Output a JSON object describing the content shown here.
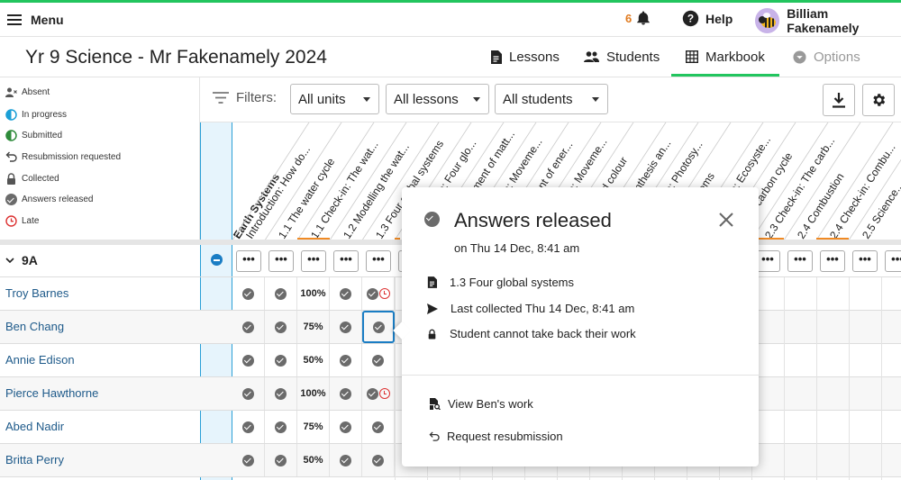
{
  "topbar": {
    "menu_label": "Menu",
    "notification_count": "6",
    "help_label": "Help",
    "user_name": "Billiam Fakenamely"
  },
  "header": {
    "title": "Yr 9 Science - Mr Fakenamely 2024",
    "tabs": [
      {
        "label": "Lessons",
        "icon": "document-icon"
      },
      {
        "label": "Students",
        "icon": "people-icon"
      },
      {
        "label": "Markbook",
        "icon": "grid-icon",
        "active": true
      },
      {
        "label": "Options",
        "icon": "chevron-circle-icon",
        "disabled": true
      }
    ]
  },
  "legend": [
    {
      "label": "Absent",
      "icon": "absent-icon"
    },
    {
      "label": "In progress",
      "icon": "in-progress-icon"
    },
    {
      "label": "Submitted",
      "icon": "submitted-icon"
    },
    {
      "label": "Resubmission requested",
      "icon": "resubmit-icon"
    },
    {
      "label": "Collected",
      "icon": "lock-icon"
    },
    {
      "label": "Answers released",
      "icon": "check-circle-icon"
    },
    {
      "label": "Late",
      "icon": "late-clock-icon"
    }
  ],
  "filters": {
    "label": "Filters:",
    "units": "All units",
    "lessons": "All lessons",
    "students": "All students"
  },
  "unit_label": "Earth Systems",
  "columns": [
    "Introduction: How do...",
    "1.1 The water cycle",
    "1.1 Check-in: The wat...",
    "1.2 Modelling the wat...",
    "1.3 Four global systems",
    "1.3 Check-in: Four glo...",
    "2.1 Management of matt...",
    "2.1 Check-in: Moveme...",
    "2.2 Movement of ener...",
    "2.2 Check-in: Moveme...",
    "2.3 Light and colour",
    "2.4 Photosynthesis an...",
    "2.4 Check-in: Photosy...",
    "2.5 Ecosystems",
    "2.5 Check-in: Ecosyste...",
    "2.3 The carbon cycle",
    "2.3 Check-in: The carb...",
    "2.4 Combustion",
    "2.4 Check-in: Combu...",
    "2.5 Science..."
  ],
  "class_name": "9A",
  "students": [
    {
      "name": "Troy Barnes",
      "c3": "100%",
      "c5_late": true
    },
    {
      "name": "Ben Chang",
      "c3": "75%",
      "c5_late": false
    },
    {
      "name": "Annie Edison",
      "c3": "50%",
      "c5_late": false
    },
    {
      "name": "Pierce Hawthorne",
      "c3": "100%",
      "c5_late": true
    },
    {
      "name": "Abed Nadir",
      "c3": "75%",
      "c5_late": false
    },
    {
      "name": "Britta Perry",
      "c3": "50%",
      "c5_late": false
    }
  ],
  "popup": {
    "title": "Answers released",
    "subtitle": "on Thu 14 Dec, 8:41 am",
    "lesson": "1.3 Four global systems",
    "collected": "Last collected Thu 14 Dec, 8:41 am",
    "lock_note": "Student cannot take back their work",
    "view_work": "View Ben's work",
    "request_resubmission": "Request resubmission"
  },
  "colors": {
    "accent_green": "#22c55e",
    "unit_blue": "#2a9fd6",
    "link_blue": "#1e5a8a",
    "late_red": "#dd3333",
    "orange": "#f08a24"
  }
}
